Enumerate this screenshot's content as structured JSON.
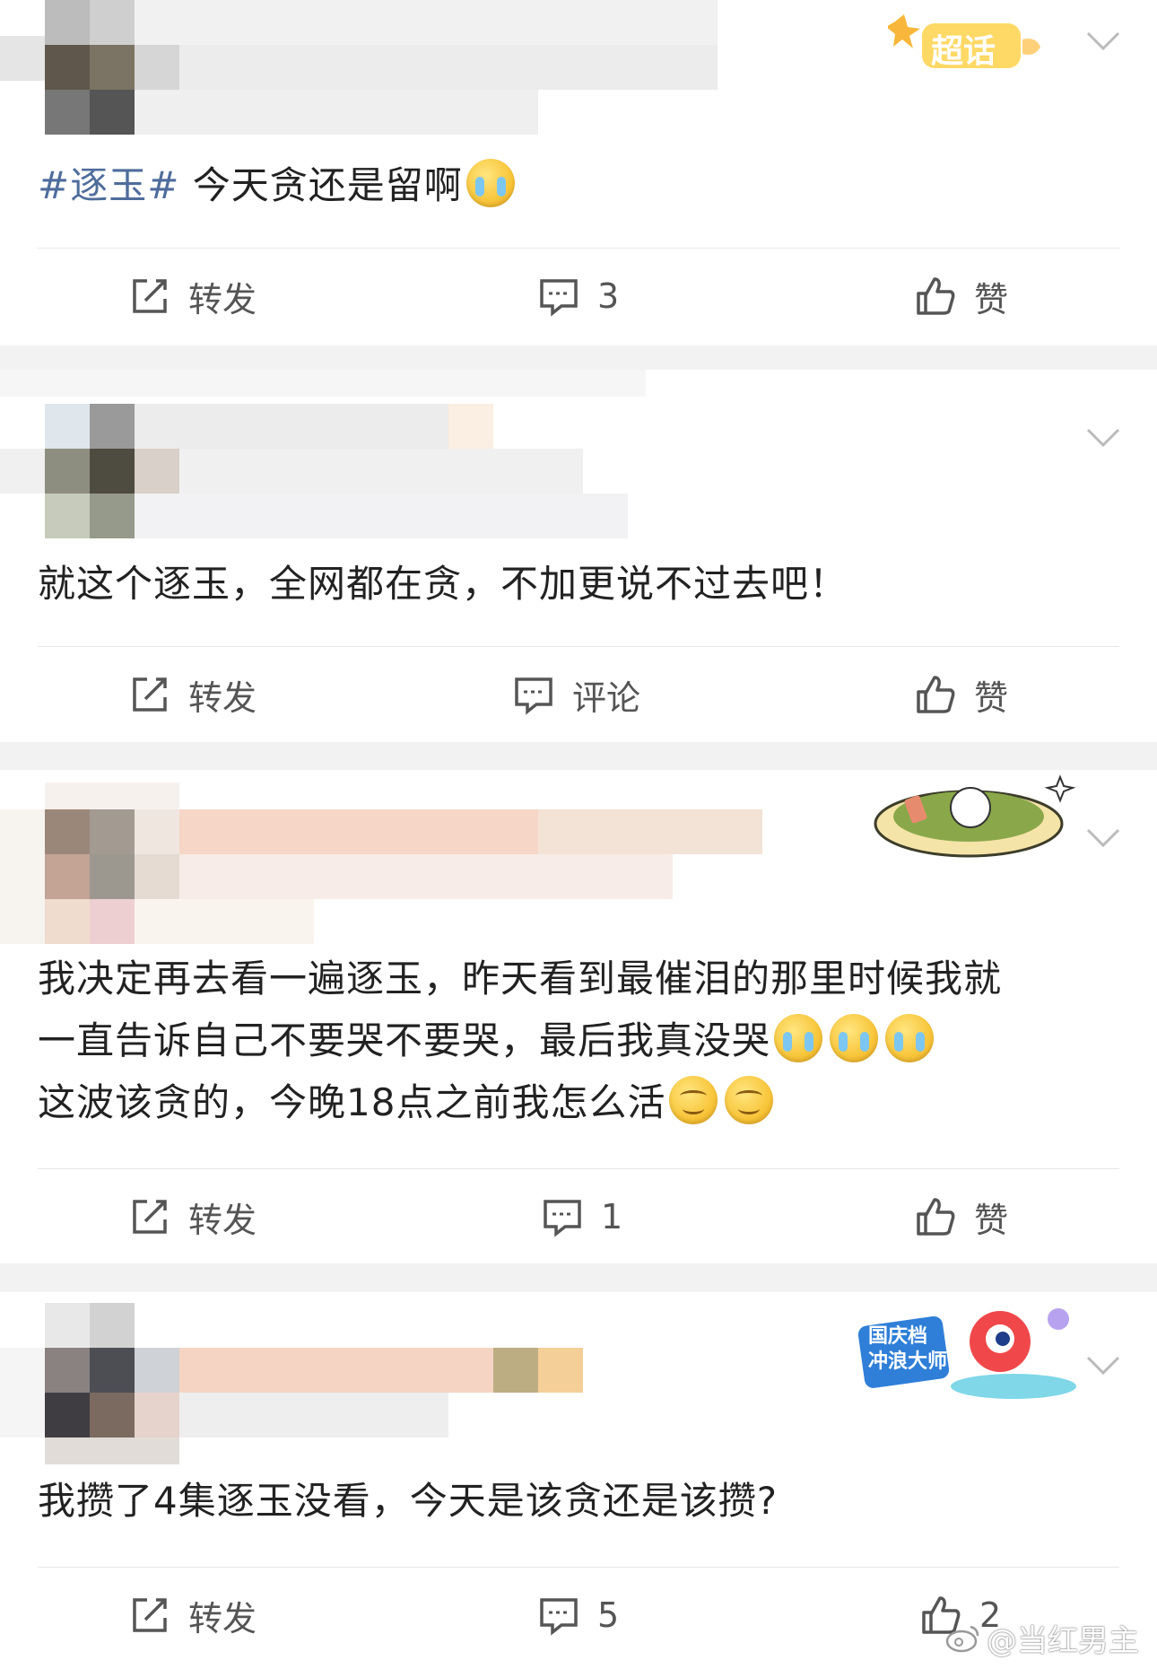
{
  "posts": [
    {
      "badge": "超话",
      "topic": "#逐玉#",
      "text": " 今天贪还是留啊",
      "emojis": [
        "cry"
      ],
      "actions": {
        "repost": "转发",
        "comment": "3",
        "like": "赞"
      }
    },
    {
      "text": "就这个逐玉，全网都在贪，不加更说不过去吧！",
      "actions": {
        "repost": "转发",
        "comment": "评论",
        "like": "赞"
      }
    },
    {
      "line1": "我决定再去看一遍逐玉，昨天看到最催泪的那里时候我就",
      "line2": "一直告诉自己不要哭不要哭，最后我真没哭",
      "line3": "这波该贪的，今晚18点之前我怎么活",
      "actions": {
        "repost": "转发",
        "comment": "1",
        "like": "赞"
      }
    },
    {
      "badge": "国庆档 冲浪大师",
      "text": "我攒了4集逐玉没看，今天是该贪还是该攒?",
      "actions": {
        "repost": "转发",
        "comment": "5",
        "like": "2"
      }
    }
  ],
  "watermark": "@当红男主",
  "colors": {
    "topic": "#4f6d9c",
    "background": "#f2f2f2",
    "text": "#222222",
    "action": "#555555"
  }
}
